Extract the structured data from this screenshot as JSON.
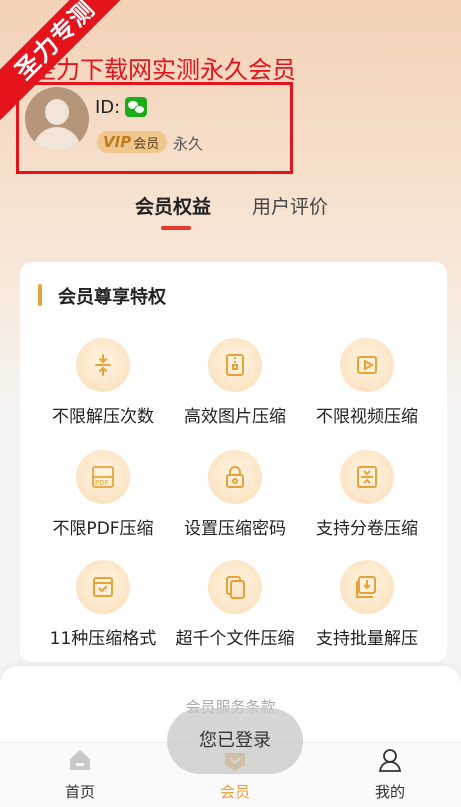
{
  "watermark": {
    "corner_text": "圣力专测",
    "banner_text": "圣力下载网实测永久会员"
  },
  "profile": {
    "id_label": "ID:",
    "vip_mark": "VIP",
    "vip_text": "会员",
    "term": "永久"
  },
  "tabs": [
    {
      "label": "会员权益",
      "active": true
    },
    {
      "label": "用户评价",
      "active": false
    }
  ],
  "card": {
    "title": "会员尊享特权",
    "features": [
      {
        "label": "不限解压次数",
        "icon": "compress-arrows-icon"
      },
      {
        "label": "高效图片压缩",
        "icon": "image-zip-icon"
      },
      {
        "label": "不限视频压缩",
        "icon": "video-icon"
      },
      {
        "label": "不限PDF压缩",
        "icon": "pdf-icon"
      },
      {
        "label": "设置压缩密码",
        "icon": "lock-icon"
      },
      {
        "label": "支持分卷压缩",
        "icon": "split-volume-icon"
      },
      {
        "label": "11种压缩格式",
        "icon": "format-box-icon"
      },
      {
        "label": "超千个文件压缩",
        "icon": "files-icon"
      },
      {
        "label": "支持批量解压",
        "icon": "batch-extract-icon"
      }
    ]
  },
  "terms": "会员服务条款",
  "toast": "您已登录",
  "tabbar": [
    {
      "label": "首页",
      "icon": "home-icon",
      "active": false
    },
    {
      "label": "会员",
      "icon": "vip-icon",
      "active": true
    },
    {
      "label": "我的",
      "icon": "user-icon",
      "active": false
    }
  ],
  "colors": {
    "accent": "#e8a23a",
    "watermark_red": "#e5141c",
    "tab_underline": "#e8372d"
  }
}
